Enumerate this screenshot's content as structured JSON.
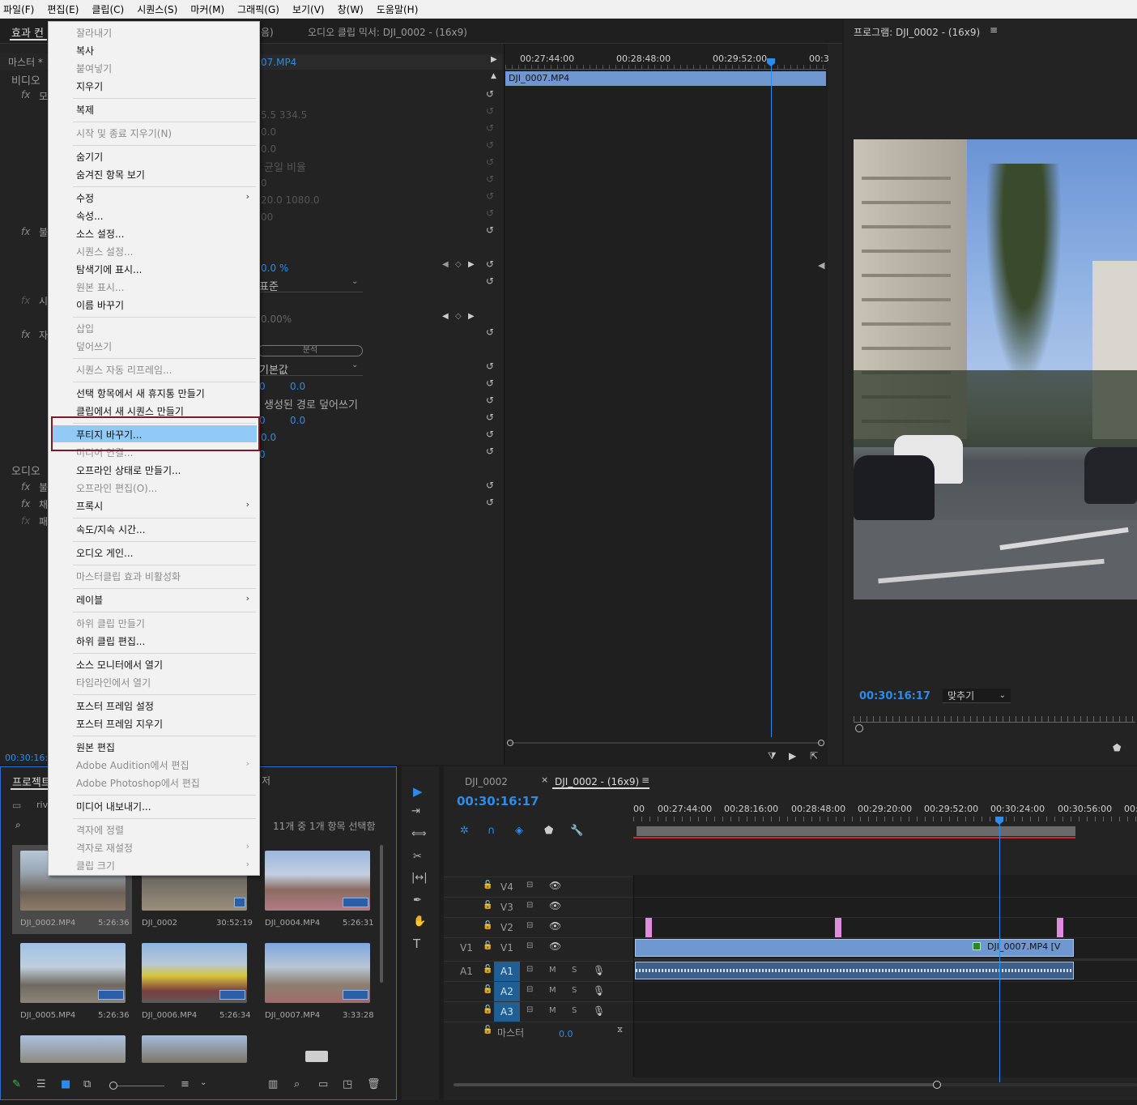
{
  "menubar": [
    "파일(F)",
    "편집(E)",
    "클립(C)",
    "시퀀스(S)",
    "마커(M)",
    "그래픽(G)",
    "보기(V)",
    "창(W)",
    "도움말(H)"
  ],
  "effects_panel": {
    "tab_effects": "효과 컨",
    "tab_audio_mixer": "오디오 클립 믹서: DJI_0002 - (16x9)",
    "tab_audio_suffix": "음)",
    "master_label": "마스터 *",
    "clip_name": "07.MP4",
    "video_label": "비디오",
    "audio_label": "오디오",
    "timecode": "00:30:16:1",
    "values": {
      "pos": "5.5    334.5",
      "v1": "0.0",
      "v2": "0.0",
      "uniform": "균일 비율",
      "v3": "0",
      "anchor": "20.0    1080.0",
      "v4": "00",
      "opacity": "0.0 %",
      "blend": "표준",
      "speed": "0.00%",
      "analyze": "분석",
      "default": "기본값",
      "a1": "0",
      "a2": "0.0",
      "path_overwrite": "생성된 경로 덮어쓰기",
      "b1": "0",
      "b2": "0.0",
      "c1": "0.0",
      "c2": "0"
    },
    "side_labels": [
      "모",
      "불",
      "시",
      "자",
      "불",
      "채",
      "패"
    ],
    "timeline_ticks": [
      "00:27:44:00",
      "00:28:48:00",
      "00:29:52:00",
      "00:3"
    ],
    "clip_bar": "DJI_0007.MP4"
  },
  "edit_menu": {
    "items": [
      {
        "label": "잘라내기",
        "disabled": true
      },
      {
        "label": "복사",
        "disabled": false
      },
      {
        "label": "붙여넣기",
        "disabled": true
      },
      {
        "label": "지우기",
        "disabled": false
      },
      {
        "label": "복제",
        "disabled": false
      },
      {
        "label": "시작 및 종료 지우기(N)",
        "disabled": true
      },
      {
        "label": "숨기기",
        "disabled": false
      },
      {
        "label": "숨겨진 항목 보기",
        "disabled": false
      },
      {
        "label": "수정",
        "disabled": false,
        "submenu": true
      },
      {
        "label": "속성...",
        "disabled": false
      },
      {
        "label": "소스 설정...",
        "disabled": false
      },
      {
        "label": "시퀀스 설정...",
        "disabled": true
      },
      {
        "label": "탐색기에 표시...",
        "disabled": false
      },
      {
        "label": "원본 표시...",
        "disabled": true
      },
      {
        "label": "이름 바꾸기",
        "disabled": false
      },
      {
        "label": "삽입",
        "disabled": true
      },
      {
        "label": "덮어쓰기",
        "disabled": true
      },
      {
        "label": "시퀀스 자동 리프레임...",
        "disabled": true
      },
      {
        "label": "선택 항목에서 새 휴지통 만들기",
        "disabled": false
      },
      {
        "label": "클립에서 새 시퀀스 만들기",
        "disabled": false
      },
      {
        "label": "푸티지 바꾸기...",
        "disabled": false,
        "highlighted": true
      },
      {
        "label": "미디어 연결...",
        "disabled": true
      },
      {
        "label": "오프라인 상태로 만들기...",
        "disabled": false
      },
      {
        "label": "오프라인 편집(O)...",
        "disabled": true
      },
      {
        "label": "프록시",
        "disabled": false,
        "submenu": true
      },
      {
        "label": "속도/지속 시간...",
        "disabled": false
      },
      {
        "label": "오디오 게인...",
        "disabled": false
      },
      {
        "label": "마스터클립 효과 비활성화",
        "disabled": true
      },
      {
        "label": "레이블",
        "disabled": false,
        "submenu": true
      },
      {
        "label": "하위 클립 만들기",
        "disabled": true
      },
      {
        "label": "하위 클립 편집...",
        "disabled": false
      },
      {
        "label": "소스 모니터에서 열기",
        "disabled": false
      },
      {
        "label": "타임라인에서 열기",
        "disabled": true
      },
      {
        "label": "포스터 프레임 설정",
        "disabled": false
      },
      {
        "label": "포스터 프레임 지우기",
        "disabled": false
      },
      {
        "label": "원본 편집",
        "disabled": false
      },
      {
        "label": "Adobe Audition에서 편집",
        "disabled": true,
        "submenu": true
      },
      {
        "label": "Adobe Photoshop에서 편집",
        "disabled": true
      },
      {
        "label": "미디어 내보내기...",
        "disabled": false
      },
      {
        "label": "격자에 정렬",
        "disabled": true
      },
      {
        "label": "격자로 재설정",
        "disabled": true,
        "submenu": true
      },
      {
        "label": "클립 크기",
        "disabled": true,
        "submenu": true
      }
    ]
  },
  "program_monitor": {
    "title": "프로그램: DJI_0002 - (16x9)",
    "timecode": "00:30:16:17",
    "fit": "맞추기"
  },
  "project_panel": {
    "tab": "프로젝트",
    "tab_suffix": "저",
    "folder": "riv",
    "selection_info": "11개 중 1개 항목 선택함",
    "items": [
      {
        "name": "DJI_0002.MP4",
        "duration": "5:26:36"
      },
      {
        "name": "DJI_0002",
        "duration": "30:52:19"
      },
      {
        "name": "DJI_0004.MP4",
        "duration": "5:26:31"
      },
      {
        "name": "DJI_0005.MP4",
        "duration": "5:26:36"
      },
      {
        "name": "DJI_0006.MP4",
        "duration": "5:26:34"
      },
      {
        "name": "DJI_0007.MP4",
        "duration": "3:33:28"
      }
    ]
  },
  "timeline": {
    "tab1": "DJI_0002",
    "tab2": "DJI_0002 - (16x9)",
    "timecode": "00:30:16:17",
    "ticks": [
      "00",
      "00:27:44:00",
      "00:28:16:00",
      "00:28:48:00",
      "00:29:20:00",
      "00:29:52:00",
      "00:30:24:00",
      "00:30:56:00",
      "00:"
    ],
    "video_tracks": [
      "V4",
      "V3",
      "V2",
      "V1"
    ],
    "audio_tracks": [
      "A1",
      "A2",
      "A3"
    ],
    "source_v": "V1",
    "source_a": "A1",
    "master_label": "마스터",
    "master_value": "0.0",
    "clip_label": "DJI_0007.MP4 [V",
    "m": "M",
    "s": "S"
  }
}
